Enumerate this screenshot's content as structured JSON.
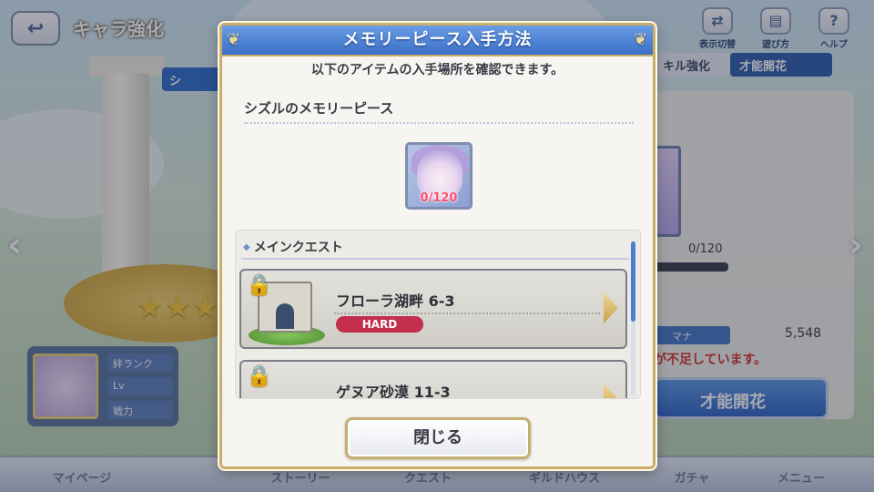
{
  "background": {
    "screen_title": "キャラ強化",
    "top_tab_left": "シ",
    "top_icons": [
      {
        "label": "表示切替",
        "icon": "view-toggle-icon"
      },
      {
        "label": "遊び方",
        "icon": "help-book-icon"
      },
      {
        "label": "ヘルプ",
        "icon": "question-icon"
      }
    ],
    "right_tabs": [
      {
        "label": "キル強化"
      },
      {
        "label": "才能開花"
      }
    ],
    "piece_count": "0/120",
    "mana_label": "マナ",
    "mana_value": "5,548",
    "warning": "が不足しています。",
    "bloom_button": "才能開花",
    "char_rows": [
      "絆ランク",
      "Lv",
      "戦力"
    ],
    "bottom_nav": [
      "マイページ",
      "ストーリー",
      "クエスト",
      "ギルドハウス",
      "ガチャ",
      "メニュー"
    ]
  },
  "modal": {
    "title": "メモリーピース入手方法",
    "description": "以下のアイテムの入手場所を確認できます。",
    "piece_title": "シズルのメモリーピース",
    "piece_count": "0/120",
    "section_title": "メインクエスト",
    "quests": [
      {
        "name": "フローラ湖畔 6-3",
        "badge": "HARD"
      },
      {
        "name": "ゲヌア砂漠 11-3",
        "badge": ""
      }
    ],
    "close_label": "閉じる"
  },
  "colors": {
    "header_blue": "#3a6fc5",
    "gold_border": "#c9ad6a",
    "hard_badge": "#c22e4c",
    "count_pink": "#ff4e6a"
  }
}
